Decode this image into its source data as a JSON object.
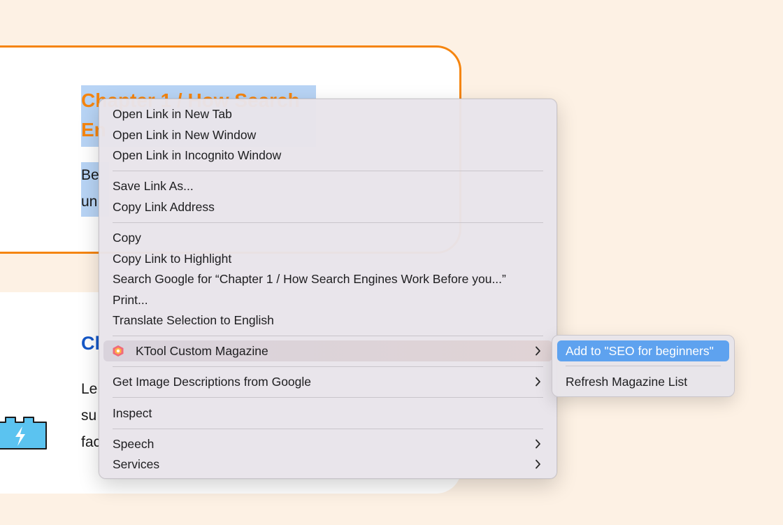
{
  "page": {
    "card1": {
      "heading_line1": "Chapter 1 / How Search",
      "heading_line2": "En",
      "body_line1": "Be",
      "body_line2": "un"
    },
    "card2": {
      "heading": "Cl",
      "body_line1": "Le",
      "body_line2": "su",
      "body_line3": "fac"
    }
  },
  "context_menu": {
    "items": [
      {
        "label": "Open Link in New Tab"
      },
      {
        "label": "Open Link in New Window"
      },
      {
        "label": "Open Link in Incognito Window"
      },
      {
        "label": "Save Link As..."
      },
      {
        "label": "Copy Link Address"
      },
      {
        "label": "Copy"
      },
      {
        "label": "Copy Link to Highlight"
      },
      {
        "label": "Search Google for “Chapter 1 / How Search Engines Work Before you...”"
      },
      {
        "label": "Print..."
      },
      {
        "label": "Translate Selection to English"
      },
      {
        "label": "KTool Custom Magazine",
        "icon": "ktool-extension-icon",
        "submenu": true
      },
      {
        "label": "Get Image Descriptions from Google",
        "submenu": true
      },
      {
        "label": "Inspect"
      },
      {
        "label": "Speech",
        "submenu": true
      },
      {
        "label": "Services",
        "submenu": true
      }
    ]
  },
  "submenu": {
    "items": [
      {
        "label": "Add to \"SEO for beginners\"",
        "active": true
      },
      {
        "label": "Refresh Magazine List"
      }
    ]
  },
  "colors": {
    "accent_orange": "#f5850f",
    "heading_blue": "#1558c8",
    "selection": "#b8d4f5",
    "menu_highlight": "#5ea2ef",
    "background": "#fdf1e4"
  }
}
